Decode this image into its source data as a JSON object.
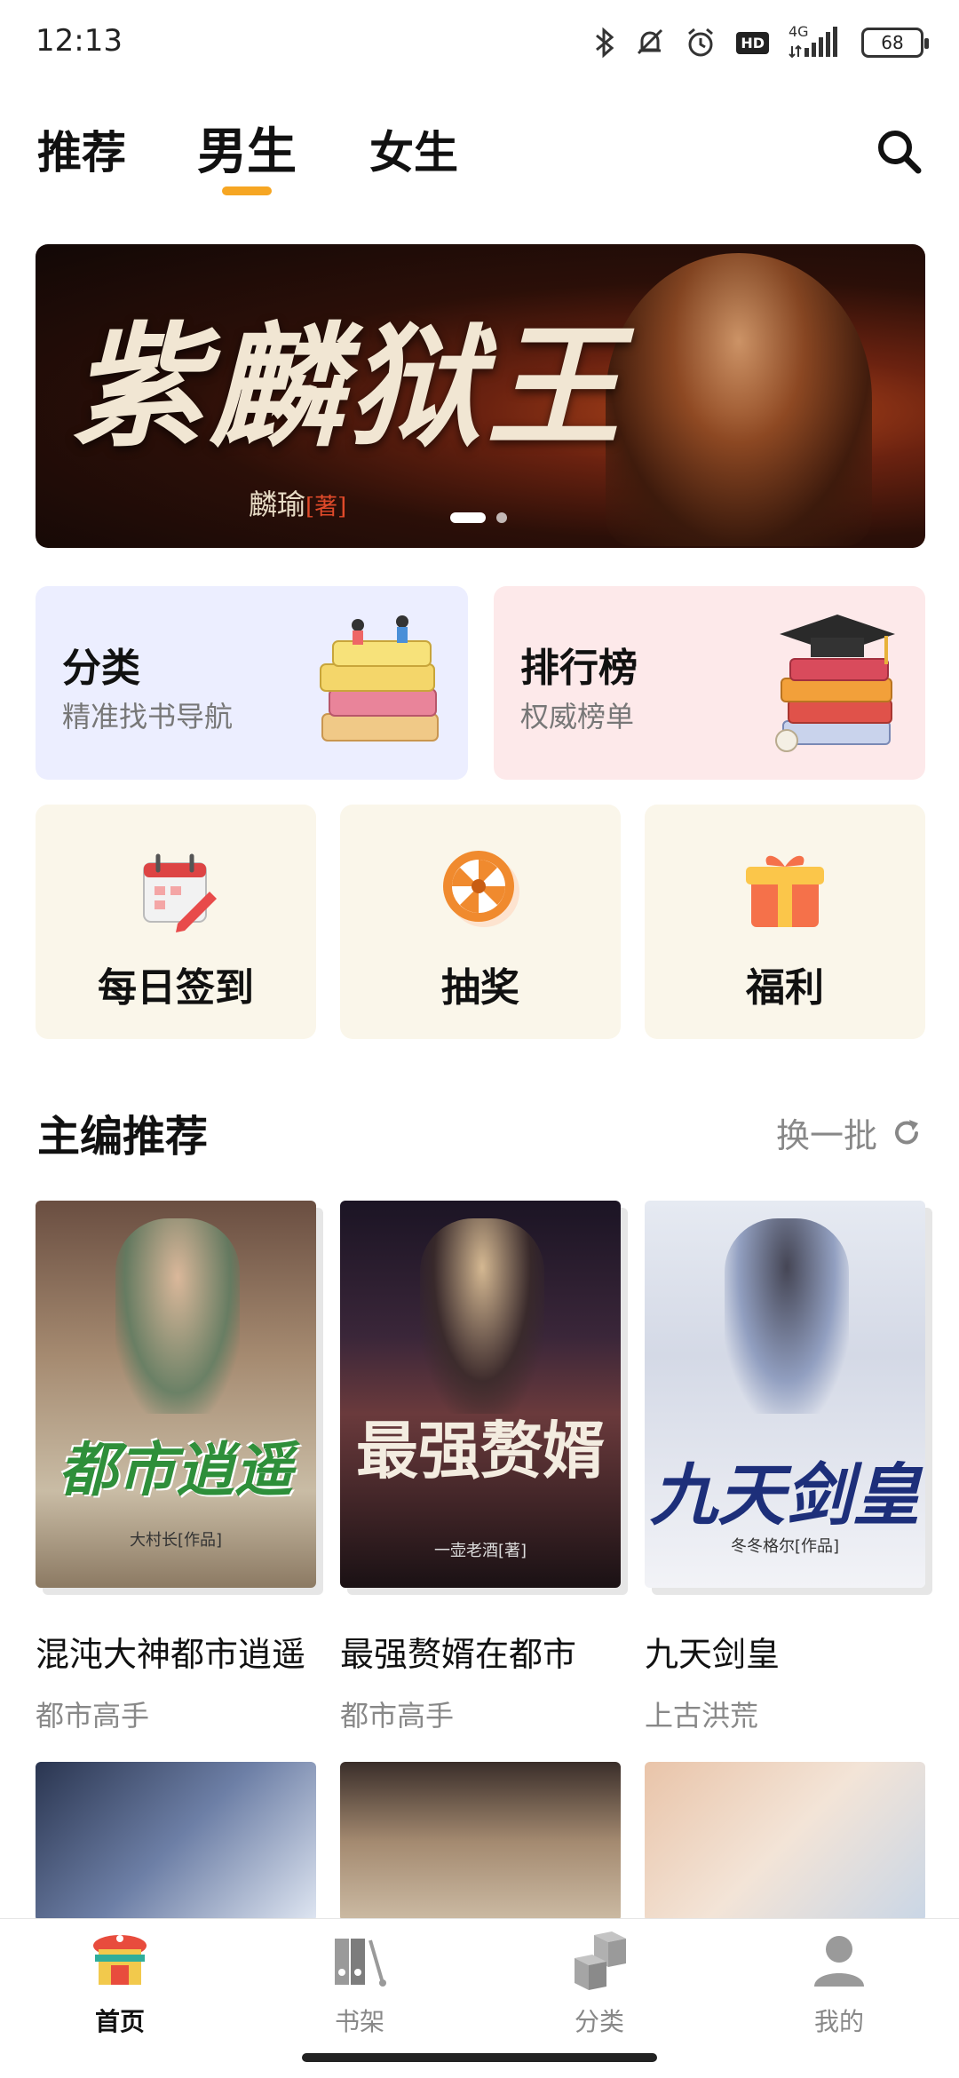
{
  "status_bar": {
    "time": "12:13",
    "network": "4G",
    "battery": "68",
    "hd_badge": "HD",
    "icons": [
      "bluetooth-icon",
      "bell-off-icon",
      "alarm-icon",
      "hd-icon",
      "signal-icon",
      "battery-icon"
    ]
  },
  "top_tabs": {
    "items": [
      {
        "label": "推荐"
      },
      {
        "label": "男生",
        "selected": true
      },
      {
        "label": "女生"
      }
    ],
    "indicator_color": "#f6a623",
    "search_icon": "search-icon"
  },
  "banner": {
    "title": "紫麟狱王",
    "author": "麟瑜",
    "author_tag": "[著]",
    "slides_total": 2,
    "active_slide": 1
  },
  "features": [
    {
      "title": "分类",
      "subtitle": "精准找书导航",
      "color": "#eceeff"
    },
    {
      "title": "排行榜",
      "subtitle": "权威榜单",
      "color": "#fde9ea"
    }
  ],
  "quick_entries": [
    {
      "label": "每日签到",
      "icon": "calendar-icon"
    },
    {
      "label": "抽奖",
      "icon": "wheel-icon"
    },
    {
      "label": "福利",
      "icon": "gift-icon"
    }
  ],
  "section": {
    "title": "主编推荐",
    "refresh_label": "换一批",
    "refresh_icon": "refresh-icon"
  },
  "books": [
    {
      "name": "混沌大神都市逍遥",
      "genre": "都市高手",
      "cover_title": "都市逍遥",
      "cover_author": "大村长[作品]"
    },
    {
      "name": "最强赘婿在都市",
      "genre": "都市高手",
      "cover_title": "最强赘婿",
      "cover_author": "一壶老酒[著]"
    },
    {
      "name": "九天剑皇",
      "genre": "上古洪荒",
      "cover_title": "九天剑皇",
      "cover_author": "冬冬格尔[作品]"
    }
  ],
  "bottom_nav": [
    {
      "label": "首页",
      "icon": "home-icon",
      "active": true
    },
    {
      "label": "书架",
      "icon": "bookshelf-icon"
    },
    {
      "label": "分类",
      "icon": "category-icon"
    },
    {
      "label": "我的",
      "icon": "profile-icon"
    }
  ]
}
